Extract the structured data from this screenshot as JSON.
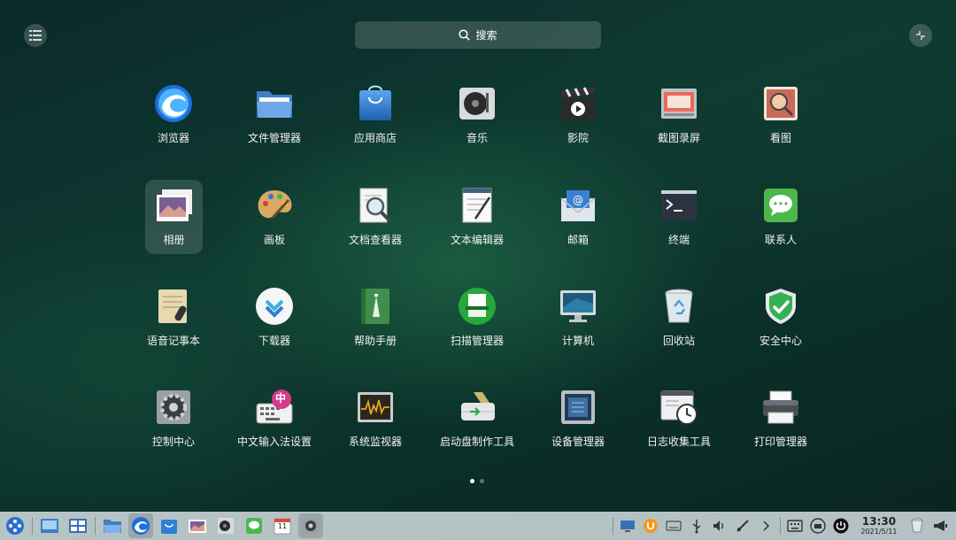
{
  "search": {
    "label": "搜索"
  },
  "apps": [
    {
      "label": "浏览器",
      "icon": "browser-icon"
    },
    {
      "label": "文件管理器",
      "icon": "folder-icon"
    },
    {
      "label": "应用商店",
      "icon": "app-store-icon"
    },
    {
      "label": "音乐",
      "icon": "music-icon"
    },
    {
      "label": "影院",
      "icon": "movie-icon"
    },
    {
      "label": "截图录屏",
      "icon": "screenshot-icon"
    },
    {
      "label": "看图",
      "icon": "image-viewer-icon"
    },
    {
      "label": "相册",
      "icon": "album-icon"
    },
    {
      "label": "画板",
      "icon": "palette-icon"
    },
    {
      "label": "文档查看器",
      "icon": "document-viewer-icon"
    },
    {
      "label": "文本编辑器",
      "icon": "text-editor-icon"
    },
    {
      "label": "邮箱",
      "icon": "mail-icon"
    },
    {
      "label": "终端",
      "icon": "terminal-icon"
    },
    {
      "label": "联系人",
      "icon": "contacts-icon"
    },
    {
      "label": "语音记事本",
      "icon": "voice-notes-icon"
    },
    {
      "label": "下载器",
      "icon": "downloader-icon"
    },
    {
      "label": "帮助手册",
      "icon": "help-manual-icon"
    },
    {
      "label": "扫描管理器",
      "icon": "scanner-icon"
    },
    {
      "label": "计算机",
      "icon": "computer-icon"
    },
    {
      "label": "回收站",
      "icon": "trash-icon"
    },
    {
      "label": "安全中心",
      "icon": "security-shield-icon"
    },
    {
      "label": "控制中心",
      "icon": "control-center-gear-icon"
    },
    {
      "label": "中文输入法设置",
      "icon": "input-method-icon"
    },
    {
      "label": "系统监视器",
      "icon": "system-monitor-icon"
    },
    {
      "label": "启动盘制作工具",
      "icon": "boot-maker-icon"
    },
    {
      "label": "设备管理器",
      "icon": "device-manager-icon"
    },
    {
      "label": "日志收集工具",
      "icon": "log-collector-icon"
    },
    {
      "label": "打印管理器",
      "icon": "printer-icon"
    }
  ],
  "input_method_badge": "中",
  "pagination": {
    "pages": 2,
    "current": 1
  },
  "taskbar": {
    "calendar_day": "11",
    "clock": {
      "time": "13:30",
      "date": "2021/5/11"
    }
  }
}
